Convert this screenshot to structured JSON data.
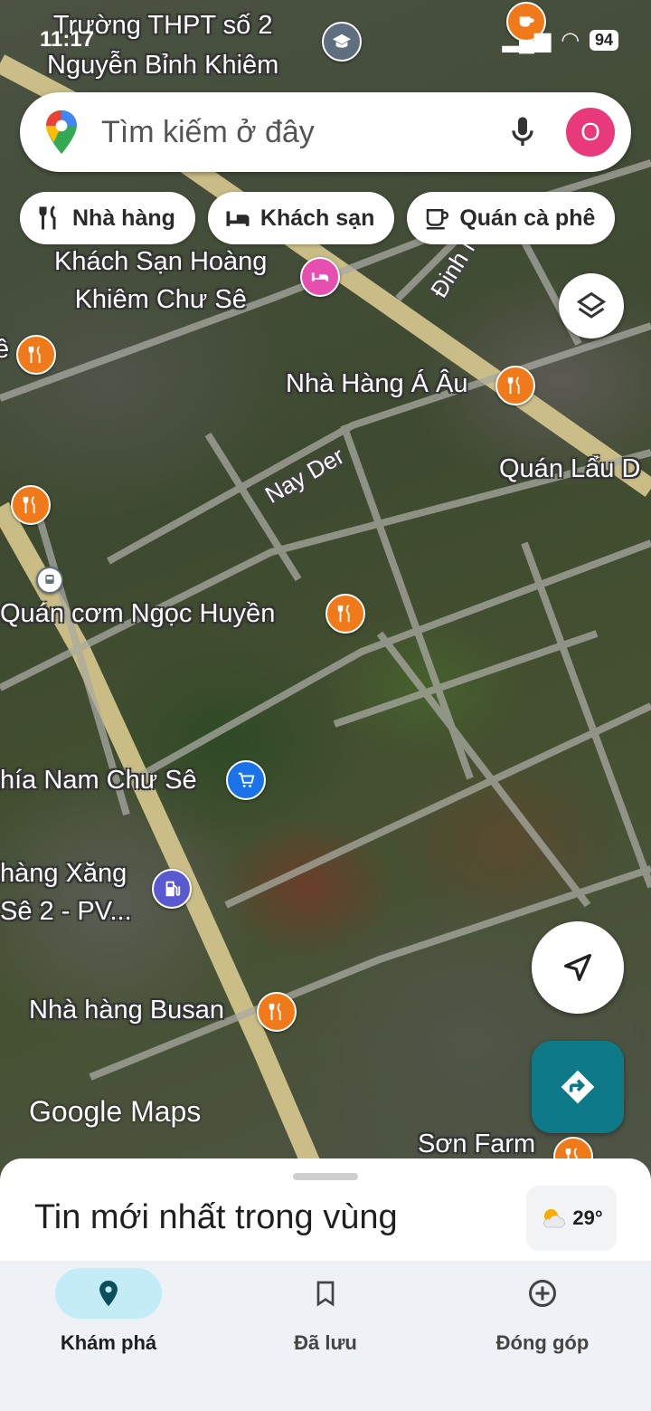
{
  "status_bar": {
    "time": "11:17",
    "battery": "94"
  },
  "search": {
    "placeholder": "Tìm kiếm ở đây",
    "avatar_letter": "O"
  },
  "chips": [
    {
      "label": "Nhà hàng",
      "icon": "restaurant-icon"
    },
    {
      "label": "Khách sạn",
      "icon": "hotel-icon"
    },
    {
      "label": "Quán cà phê",
      "icon": "coffee-icon"
    }
  ],
  "map": {
    "places": {
      "school": "Trường THPT số 2\nNguyễn Bỉnh Khiêm",
      "hotel": "Khách Sạn Hoàng\nKhiêm Chư Sê",
      "restaurant_au": "Nhà Hàng Á Âu",
      "hotpot": "Quán Lẩu D",
      "rice": "Quán cơm Ngọc Huyền",
      "market": "hía Nam Chư Sê",
      "gas": "hàng Xăng\nSê 2 - PV...",
      "busan": "Nhà hàng Busan",
      "farm": "Sơn Farm",
      "left_edge": "ê"
    },
    "roads": {
      "dinh_nup": "Đinh Núp",
      "nay_der": "Nay Der"
    },
    "watermark_google": "Google",
    "watermark_maps": "Maps"
  },
  "sheet": {
    "title": "Tin mới nhất trong vùng",
    "weather_temp": "29°"
  },
  "nav": {
    "explore": "Khám phá",
    "saved": "Đã lưu",
    "contribute": "Đóng góp"
  }
}
